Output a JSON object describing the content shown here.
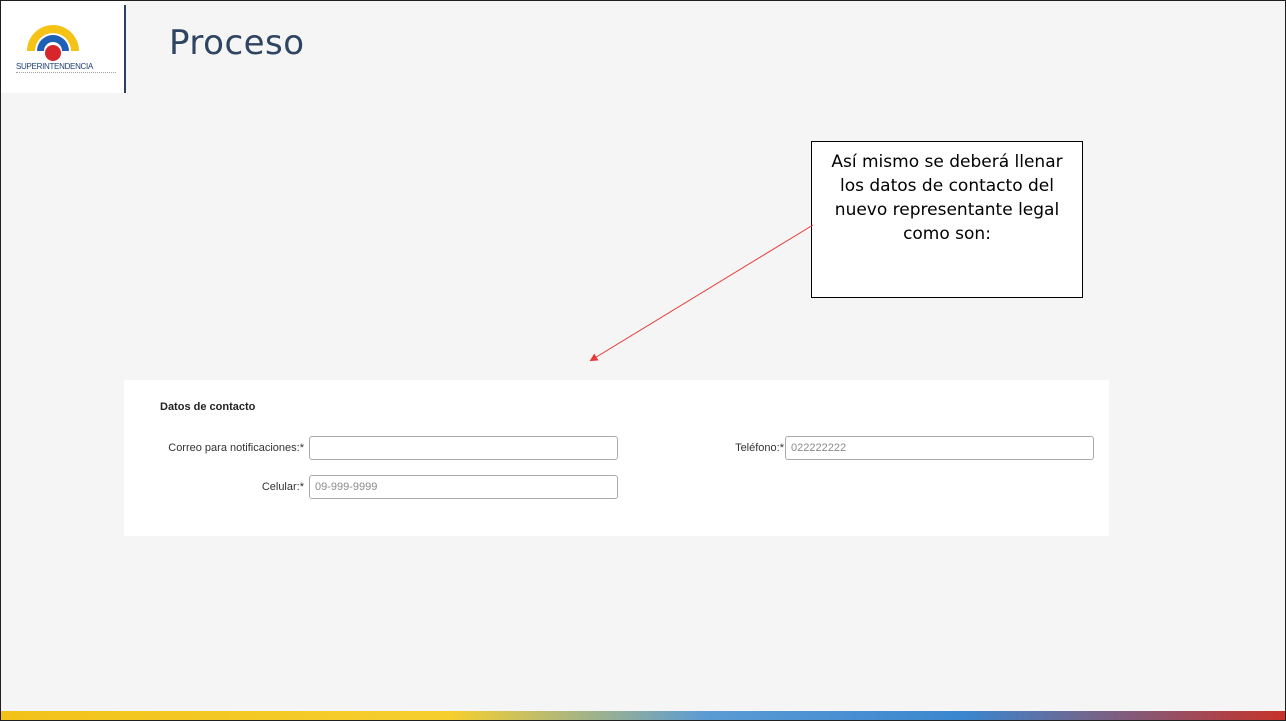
{
  "slide": {
    "title": "Proceso",
    "logo": {
      "org_name": "SUPERINTENDENCIA",
      "icon": "superintendencia-logo-icon"
    }
  },
  "callout": {
    "text": "Así mismo se deberá llenar los datos de contacto del nuevo representante legal como son:"
  },
  "form": {
    "section_title": "Datos de contacto",
    "email": {
      "label": "Correo para notificaciones:*",
      "value": "",
      "placeholder": ""
    },
    "phone": {
      "label": "Teléfono:*",
      "value": "",
      "placeholder": "022222222"
    },
    "mobile": {
      "label": "Celular:*",
      "value": "",
      "placeholder": "09-999-9999"
    }
  },
  "colors": {
    "title": "#2e4461",
    "arrow": "#e53935",
    "logo_yellow": "#f5c316",
    "logo_blue": "#1f5fb8",
    "logo_red": "#d6262c",
    "bottom_bar_yellow": "#f2c21a",
    "bottom_bar_blue": "#3a86cf",
    "bottom_bar_red": "#c8322a"
  }
}
